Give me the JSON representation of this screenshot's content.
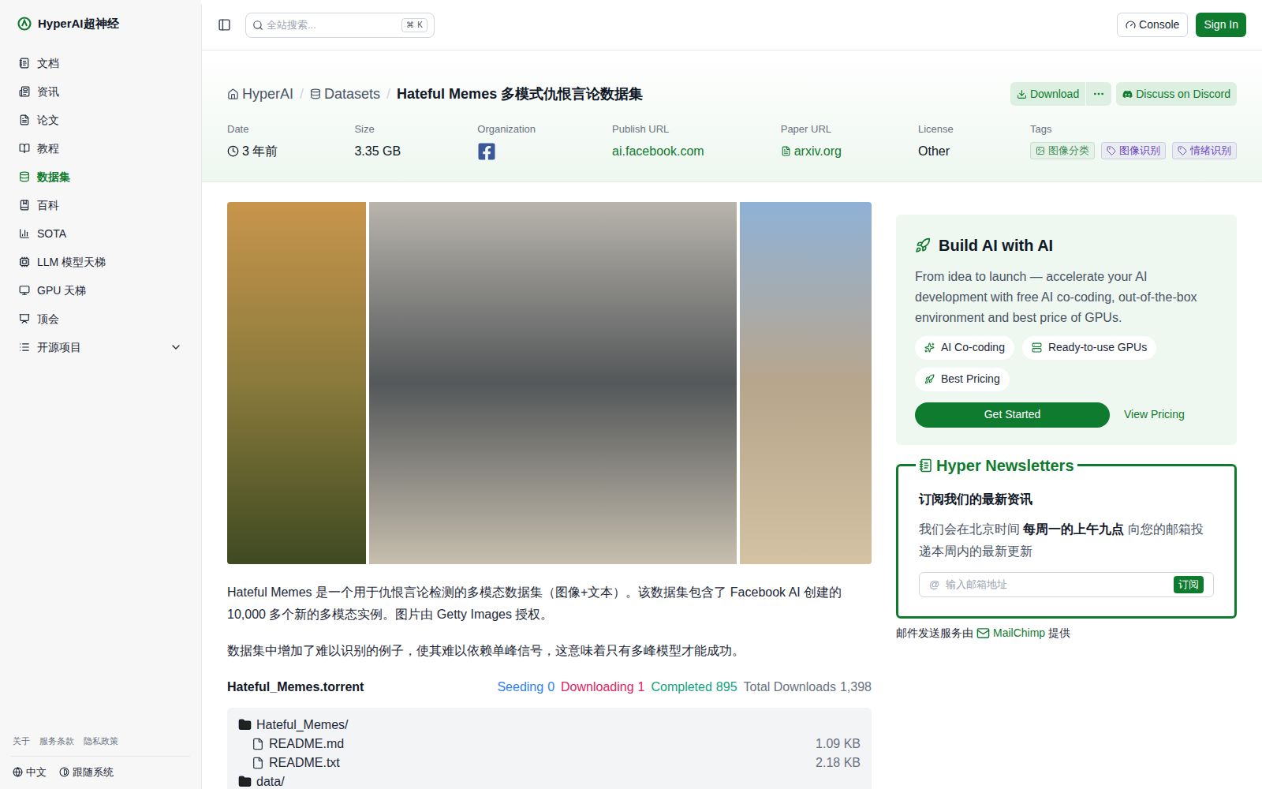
{
  "sidebar": {
    "logo": "HyperAI超神经",
    "items": [
      {
        "label": "文档",
        "selected": false
      },
      {
        "label": "资讯",
        "selected": false
      },
      {
        "label": "论文",
        "selected": false
      },
      {
        "label": "教程",
        "selected": false
      },
      {
        "label": "数据集",
        "selected": true
      },
      {
        "label": "百科",
        "selected": false
      },
      {
        "label": "SOTA",
        "selected": false
      },
      {
        "label": "LLM 模型天梯",
        "selected": false
      },
      {
        "label": "GPU 天梯",
        "selected": false
      },
      {
        "label": "顶会",
        "selected": false
      },
      {
        "label": "开源项目",
        "selected": false,
        "expanded": false
      }
    ],
    "footer_links": [
      "关于",
      "服务条款",
      "隐私政策"
    ],
    "language": "中文",
    "theme": "跟随系统"
  },
  "topbar": {
    "search_placeholder": "全站搜索...",
    "shortcut": [
      "⌘",
      "K"
    ],
    "buttons": [
      "Console",
      "Sign In"
    ]
  },
  "breadcrumb": [
    "HyperAI",
    "Datasets",
    "Hateful Memes 多模式仇恨言论数据集"
  ],
  "actions": {
    "download": "Download",
    "discord": "Discuss on Discord"
  },
  "meta": [
    {
      "label": "Date",
      "value": "3 年前",
      "kind": "time"
    },
    {
      "label": "Size",
      "value": "3.35 GB",
      "kind": "text"
    },
    {
      "label": "Organization",
      "value": "",
      "kind": "logo"
    },
    {
      "label": "Publish URL",
      "value": "ai.facebook.com",
      "kind": "link"
    },
    {
      "label": "Paper URL",
      "value": "arxiv.org",
      "kind": "paper"
    },
    {
      "label": "License",
      "value": "Other",
      "kind": "text"
    }
  ],
  "tags": {
    "label": "Tags",
    "items": [
      {
        "label": "图像分类",
        "color": "#3f8f57",
        "kind": "image"
      },
      {
        "label": "图像识别",
        "color": "#6b46c1",
        "kind": "tag"
      },
      {
        "label": "情绪识别",
        "color": "#6b46c1",
        "kind": "tag"
      }
    ]
  },
  "description": [
    "Hateful Memes 是一个用于仇恨言论检测的多模态数据集（图像+文本）。该数据集包含了 Facebook AI 创建的 10,000 多个新的多模态实例。图片由 Getty Images 授权。",
    "数据集中增加了难以识别的例子，使其难以依赖单峰信号，这意味着只有多峰模型才能成功。"
  ],
  "torrent": {
    "name": "Hateful_Memes.torrent",
    "stats": [
      {
        "label": "Seeding",
        "value": "0",
        "color": "#2f80ed"
      },
      {
        "label": "Downloading",
        "value": "1",
        "color": "#e0245e"
      },
      {
        "label": "Completed",
        "value": "895",
        "color": "#10a37f"
      },
      {
        "label": "Total Downloads",
        "value": "1,398",
        "color": "#6b7280"
      }
    ],
    "files": [
      {
        "name": "Hateful_Memes/",
        "kind": "folder",
        "depth": 0,
        "size": ""
      },
      {
        "name": "README.md",
        "kind": "file",
        "depth": 1,
        "size": "1.09 KB"
      },
      {
        "name": "README.txt",
        "kind": "file",
        "depth": 1,
        "size": "2.18 KB"
      },
      {
        "name": "data/",
        "kind": "folder",
        "depth": 0,
        "size": ""
      }
    ]
  },
  "promo": {
    "title": "Build AI with AI",
    "text": "From idea to launch — accelerate your AI development with free AI co-coding, out-of-the-box environment and best price of GPUs.",
    "chips": [
      "AI Co-coding",
      "Ready-to-use GPUs",
      "Best Pricing"
    ],
    "primary": "Get Started",
    "secondary": "View Pricing"
  },
  "newsletter": {
    "title": "Hyper Newsletters",
    "heading": "订阅我们的最新资讯",
    "text_before": "我们会在北京时间",
    "text_bold": "每周一的上午九点",
    "text_after": "向您的邮箱投递本周内的最新更新",
    "placeholder": "输入邮箱地址",
    "button": "订阅",
    "footer_before": "邮件发送服务由",
    "footer_link": "MailChimp",
    "footer_after": "提供"
  }
}
